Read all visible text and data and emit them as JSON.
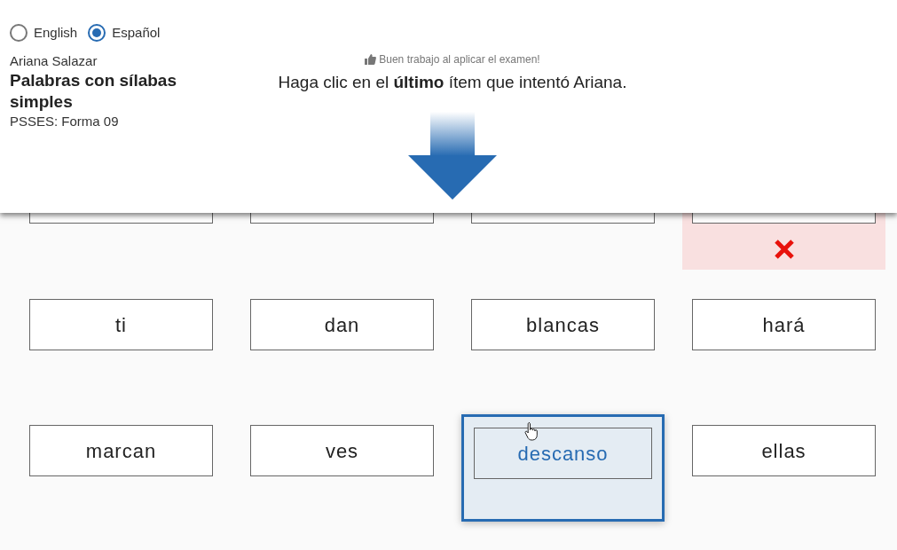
{
  "language_options": [
    {
      "label": "English",
      "selected": false
    },
    {
      "label": "Español",
      "selected": true
    }
  ],
  "student": "Ariana Salazar",
  "title": "Palabras con sílabas simples",
  "form": "PSSES: Forma 09",
  "praise": "Buen trabajo al aplicar el examen!",
  "instruction": "Haga clic en el **último** ítem que intentó Ariana.",
  "rows": [
    [
      {
        "selected": false,
        "incorrect": false
      },
      {
        "selected": false,
        "incorrect": false
      },
      {
        "selected": false,
        "incorrect": false
      },
      {
        "selected": false,
        "incorrect": true
      }
    ],
    [
      {
        "word": "ti",
        "selected": false,
        "incorrect": false
      },
      {
        "word": "dan",
        "selected": false,
        "incorrect": false
      },
      {
        "word": "blancas",
        "selected": false,
        "incorrect": false
      },
      {
        "word": "hará",
        "selected": false,
        "incorrect": false
      }
    ],
    [
      {
        "word": "marcan",
        "selected": false,
        "incorrect": false
      },
      {
        "word": "ves",
        "selected": false,
        "incorrect": false
      },
      {
        "word": "descanso",
        "selected": true,
        "incorrect": false
      },
      {
        "word": "ellas",
        "selected": false,
        "incorrect": false
      }
    ]
  ]
}
